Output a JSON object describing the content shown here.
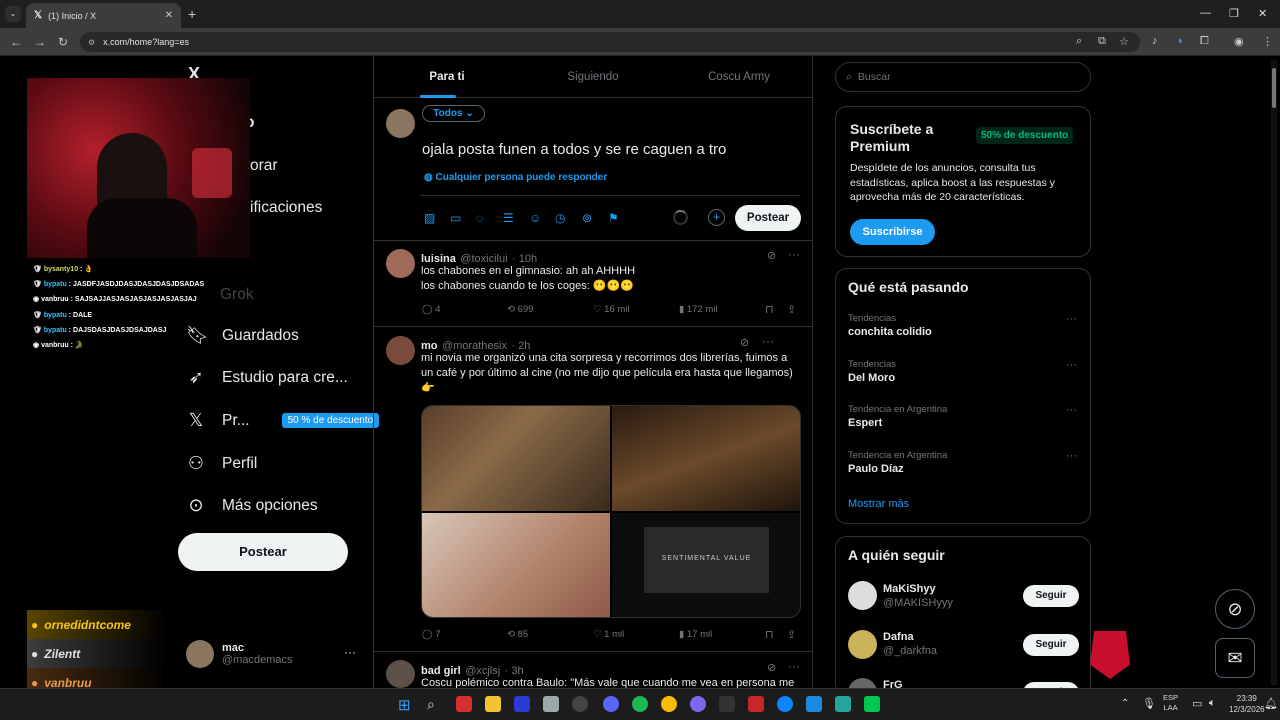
{
  "browser": {
    "tab_title": "(1) Inicio / X",
    "url": "x.com/home?lang=es"
  },
  "nav": {
    "logo": "X",
    "items_partial": [
      "o",
      "orar",
      "ificaciones"
    ],
    "grok": "Grok",
    "saved": "Guardados",
    "studio": "Estudio para cre...",
    "premium": "Pr...",
    "premium_badge": "50 % de descuento",
    "profile": "Perfil",
    "more": "Más opciones",
    "post_button": "Postear"
  },
  "account": {
    "name": "mac",
    "handle": "@macdemacs",
    "menu": "···"
  },
  "tabs": [
    "Para ti",
    "Siguiendo",
    "Coscu Army"
  ],
  "compose": {
    "audience": "Todos",
    "text": "ojala posta funen a todos y se re caguen a tro",
    "reply_setting": "Cualquier persona puede responder",
    "post_button": "Postear"
  },
  "tweets": [
    {
      "name": "luisina",
      "handle": "@toxicilui",
      "time": "· 10h",
      "lines": [
        "los chabones en el gimnasio: ah ah AHHHH",
        "los chabones cuando te los coges: 😶😶😶"
      ],
      "replies": "4",
      "retweets": "699",
      "likes": "16 mil",
      "views": "172 mil"
    },
    {
      "name": "mo",
      "handle": "@morathesix",
      "time": "· 2h",
      "lines": [
        "mi novia me organizó una cita sorpresa y recorrimos dos librerías, fuimos a",
        "un café y por último al cine (no me dijo que película era hasta que llegamos)",
        "👉"
      ],
      "replies": "7",
      "retweets": "85",
      "likes": "1 mil",
      "views": "17 mil",
      "movie_text": "SENTIMENTAL VALUE"
    },
    {
      "name": "bad girl",
      "handle": "@xcjlsj",
      "time": "· 3h",
      "lines": [
        "Coscu polémico contra Baulo: \"Más vale que cuando me vea en persona me"
      ]
    }
  ],
  "search": {
    "placeholder": "Buscar"
  },
  "premium_card": {
    "title": "Suscríbete a Premium",
    "badge": "50% de descuento",
    "body": [
      "Despídete de los anuncios, consulta tus",
      "estadísticas, aplica boost a las respuestas y",
      "aprovecha más de 20 características."
    ],
    "button": "Suscribirse"
  },
  "trends": {
    "title": "Qué está pasando",
    "items": [
      {
        "context": "Tendencias",
        "name": "conchita colidio"
      },
      {
        "context": "Tendencias",
        "name": "Del Moro"
      },
      {
        "context": "Tendencia en Argentina",
        "name": "Espert"
      },
      {
        "context": "Tendencia en Argentina",
        "name": "Paulo Díaz"
      }
    ],
    "more": "Mostrar más"
  },
  "follow": {
    "title": "A quién seguir",
    "items": [
      {
        "name": "MaKiShyy",
        "handle": "@MAKISHyyy",
        "button": "Seguir"
      },
      {
        "name": "Dafna",
        "handle": "@_darkfna",
        "button": "Seguir"
      },
      {
        "name": "FrG",
        "handle": "",
        "button": "Seguir"
      }
    ]
  },
  "chat": [
    {
      "user": "bysanty10",
      "msg": "👌"
    },
    {
      "user": "bypatu",
      "msg": "JASDFJASDJDASJDASJDASJDSADAS"
    },
    {
      "user": "vanbruu",
      "msg": "SAJSAJJASJASJASJASJASJASJAJ"
    },
    {
      "user": "bypatu",
      "msg": "DALE"
    },
    {
      "user": "bypatu",
      "msg": "DAJSDASJDASJDSAJDASJ"
    },
    {
      "user": "vanbruu",
      "msg": "🐊"
    }
  ],
  "stream_badges": [
    "ornedidntcome",
    "Zilentt",
    "vanbruu"
  ],
  "taskbar": {
    "lang1": "ESP",
    "lang2": "LAA",
    "time": "23:39",
    "date": "12/3/2026"
  }
}
